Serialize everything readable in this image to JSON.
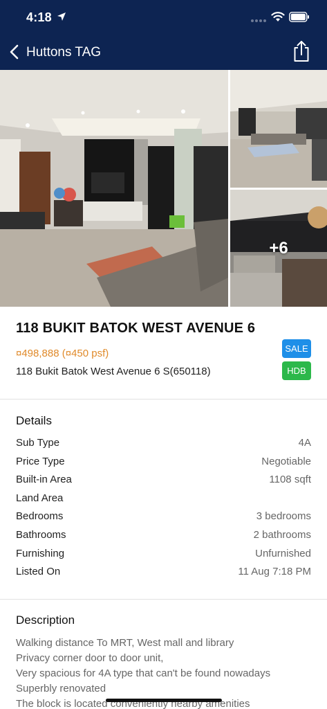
{
  "status_bar": {
    "time": "4:18",
    "icons": [
      "location-arrow-icon",
      "signal-dots-icon",
      "wifi-icon",
      "battery-icon"
    ]
  },
  "nav": {
    "back_icon": "chevron-left-icon",
    "title": "Huttons TAG",
    "share_icon": "share-icon"
  },
  "gallery": {
    "more_photos_label": "+6",
    "photos": [
      "living-room-photo",
      "living-room-corner-photo",
      "kitchen-photo"
    ]
  },
  "listing": {
    "title": "118 BUKIT BATOK WEST AVENUE 6",
    "price": "¤498,888 (¤450 psf)",
    "address": "118 Bukit Batok West Avenue 6 S(650118)",
    "badges": [
      {
        "label": "SALE",
        "color": "#1e8fe8"
      },
      {
        "label": "HDB",
        "color": "#2cb84a"
      }
    ]
  },
  "details": {
    "heading": "Details",
    "rows": [
      {
        "label": "Sub Type",
        "value": "4A"
      },
      {
        "label": "Price Type",
        "value": "Negotiable"
      },
      {
        "label": "Built-in Area",
        "value": "1108 sqft"
      },
      {
        "label": "Land Area",
        "value": ""
      },
      {
        "label": "Bedrooms",
        "value": "3 bedrooms"
      },
      {
        "label": "Bathrooms",
        "value": "2 bathrooms"
      },
      {
        "label": "Furnishing",
        "value": "Unfurnished"
      },
      {
        "label": "Listed On",
        "value": "11 Aug 7:18 PM"
      }
    ]
  },
  "description": {
    "heading": "Description",
    "lines": [
      "Walking distance To MRT, West mall and library",
      "Privacy corner door to door unit,",
      "Very spacious for 4A type that can't be found nowadays",
      "Superbly renovated",
      "The block is located conveniently nearby amenities"
    ]
  },
  "colors": {
    "header_bg": "#0d2452",
    "price": "#e08a2a",
    "sale_badge": "#1e8fe8",
    "hdb_badge": "#2cb84a"
  }
}
